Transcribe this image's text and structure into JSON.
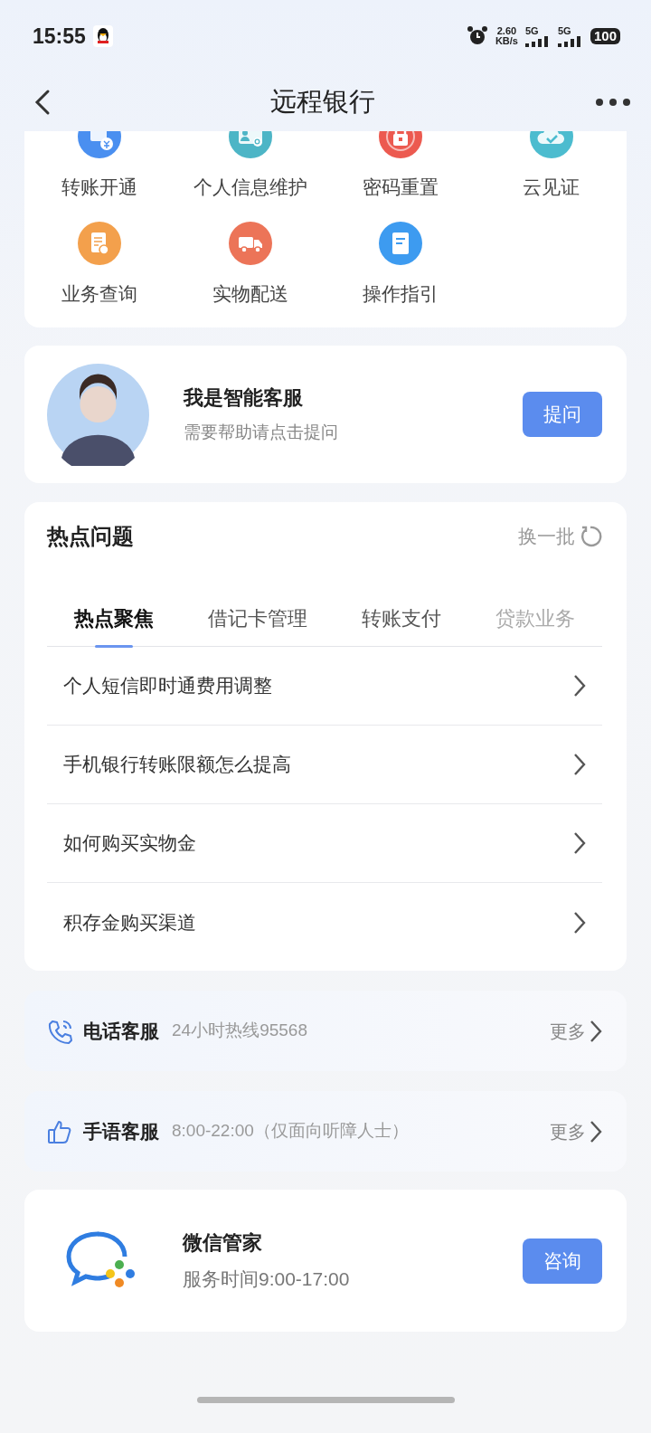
{
  "status_bar": {
    "time": "15:55",
    "speed": "2.60",
    "speed_unit": "KB/s",
    "network_1": "5G",
    "network_2": "5G",
    "battery": "100"
  },
  "header": {
    "title": "远程银行"
  },
  "services": [
    {
      "kind": "transfer",
      "label": "转账开通",
      "color": "#4a8ff0",
      "cut": true
    },
    {
      "kind": "idcard",
      "label": "个人信息维护",
      "color": "#4db5c6",
      "cut": true
    },
    {
      "kind": "lock",
      "label": "密码重置",
      "color": "#ec5a50",
      "cut": true
    },
    {
      "kind": "cloud",
      "label": "云见证",
      "color": "#4cbccf",
      "cut": true
    },
    {
      "kind": "query",
      "label": "业务查询",
      "color": "#f3a04c",
      "cut": false
    },
    {
      "kind": "truck",
      "label": "实物配送",
      "color": "#ec7458",
      "cut": false
    },
    {
      "kind": "book",
      "label": "操作指引",
      "color": "#3d9bf0",
      "cut": false
    }
  ],
  "assistant": {
    "title": "我是智能客服",
    "subtitle": "需要帮助请点击提问",
    "button": "提问"
  },
  "hot": {
    "title": "热点问题",
    "refresh": "换一批",
    "tabs": [
      {
        "label": "热点聚焦",
        "selected": true
      },
      {
        "label": "借记卡管理",
        "selected": false
      },
      {
        "label": "转账支付",
        "selected": false
      },
      {
        "label": "贷款业务",
        "selected": false
      }
    ],
    "questions": [
      "个人短信即时通费用调整",
      "手机银行转账限额怎么提高",
      "如何购买实物金",
      "积存金购买渠道"
    ]
  },
  "contacts": [
    {
      "kind": "phone",
      "title": "电话客服",
      "detail": "24小时热线95568",
      "more": "更多"
    },
    {
      "kind": "sign",
      "title": "手语客服",
      "detail": "8:00-22:00（仅面向听障人士）",
      "more": "更多"
    }
  ],
  "wechat": {
    "title": "微信管家",
    "subtitle": "服务时间9:00-17:00",
    "button": "咨询"
  }
}
